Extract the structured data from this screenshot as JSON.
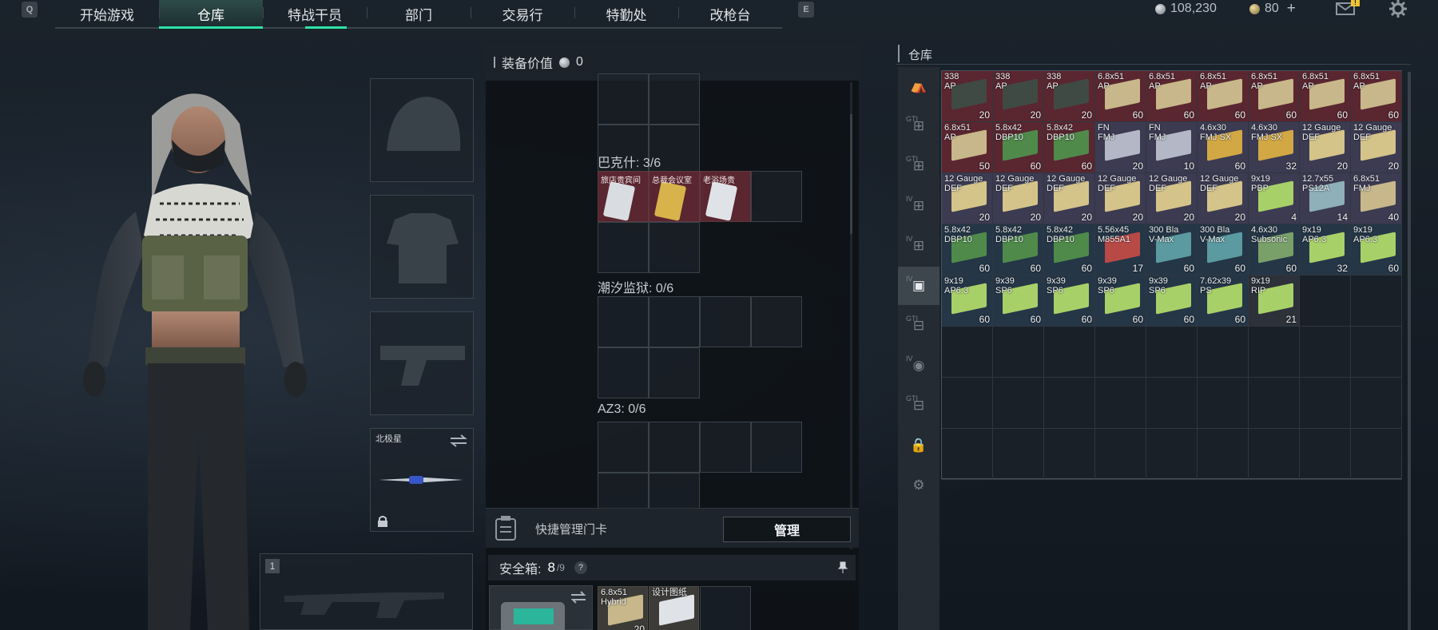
{
  "nav": {
    "left_key": "Q",
    "right_key": "E",
    "tabs": [
      {
        "label": "开始游戏",
        "active": false
      },
      {
        "label": "仓库",
        "active": true
      },
      {
        "label": "特战干员",
        "active": false
      },
      {
        "label": "部门",
        "active": false
      },
      {
        "label": "交易行",
        "active": false
      },
      {
        "label": "特勤处",
        "active": false
      },
      {
        "label": "改枪台",
        "active": false
      }
    ],
    "accent": "#2ee3a6"
  },
  "currency": {
    "silver": "108,230",
    "gold": "80",
    "add": "+",
    "mail_badge": "!"
  },
  "equipment": {
    "melee_label": "北极星"
  },
  "loadout": {
    "value_label": "装备价值",
    "value": "0",
    "sections": [
      {
        "label": "巴克什: 3/6"
      },
      {
        "label": "潮汐监狱: 0/6"
      },
      {
        "label": "AZ3: 0/6"
      }
    ],
    "keycards": [
      {
        "label": "旅店贵宾间"
      },
      {
        "label": "总裁会议室"
      },
      {
        "label": "老浴场贵"
      }
    ],
    "quick_card_label": "快捷管理门卡",
    "manage_button": "管理",
    "safebox_label": "安全箱:",
    "safebox_used": "8",
    "safebox_total": "/9",
    "safebox_help": "?",
    "safebox_items": [
      {
        "name": "6.8x51\nHybrid",
        "qty": "20"
      },
      {
        "name": "设计图纸",
        "qty": ""
      }
    ],
    "primary_slot_num": "1"
  },
  "warehouse": {
    "title": "仓库",
    "sidebar_labels": [
      "GTI",
      "GTI",
      "IV",
      "IV",
      "IV",
      "GTI",
      "IV",
      "GTI"
    ],
    "items": [
      [
        {
          "n": "338\nAP",
          "q": "20",
          "bg": "#5a2630",
          "box": "#3f4a44"
        },
        {
          "n": "338\nAP",
          "q": "20",
          "bg": "#5a2630",
          "box": "#3f4a44"
        },
        {
          "n": "338\nAP",
          "q": "20",
          "bg": "#5a2630",
          "box": "#3f4a44"
        },
        {
          "n": "6.8x51\nAP",
          "q": "60",
          "bg": "#5a2630",
          "box": "#c8b78a"
        },
        {
          "n": "6.8x51\nAP",
          "q": "60",
          "bg": "#5a2630",
          "box": "#c8b78a"
        },
        {
          "n": "6.8x51\nAP",
          "q": "60",
          "bg": "#5a2630",
          "box": "#c8b78a"
        },
        {
          "n": "6.8x51\nAP",
          "q": "60",
          "bg": "#5a2630",
          "box": "#c8b78a"
        },
        {
          "n": "6.8x51\nAP",
          "q": "60",
          "bg": "#5a2630",
          "box": "#c8b78a"
        },
        {
          "n": "6.8x51\nAP",
          "q": "60",
          "bg": "#5a2630",
          "box": "#c8b78a"
        }
      ],
      [
        {
          "n": "6.8x51\nAP",
          "q": "50",
          "bg": "#5a2630",
          "box": "#c8b78a"
        },
        {
          "n": "5.8x42\nDBP10",
          "q": "60",
          "bg": "#5a2630",
          "box": "#4f8a4a"
        },
        {
          "n": "5.8x42\nDBP10",
          "q": "60",
          "bg": "#5a2630",
          "box": "#4f8a4a"
        },
        {
          "n": "FN\nFMJ",
          "q": "20",
          "bg": "#3c3b52",
          "box": "#b4b8c6"
        },
        {
          "n": "FN\nFMJ",
          "q": "10",
          "bg": "#3c3b52",
          "box": "#b4b8c6"
        },
        {
          "n": "4.6x30\nFMJ SX",
          "q": "60",
          "bg": "#3c3b52",
          "box": "#d2a844"
        },
        {
          "n": "4.6x30\nFMJ SX",
          "q": "32",
          "bg": "#3c3b52",
          "box": "#d2a844"
        },
        {
          "n": "12 Gauge\nDEF",
          "q": "20",
          "bg": "#3c3b52",
          "box": "#d5c48a"
        },
        {
          "n": "12 Gauge\nDEF",
          "q": "20",
          "bg": "#3c3b52",
          "box": "#d5c48a"
        }
      ],
      [
        {
          "n": "12 Gauge\nDEF",
          "q": "20",
          "bg": "#3c3b52",
          "box": "#d5c48a"
        },
        {
          "n": "12 Gauge\nDEF",
          "q": "20",
          "bg": "#3c3b52",
          "box": "#d5c48a"
        },
        {
          "n": "12 Gauge\nDEF",
          "q": "20",
          "bg": "#3c3b52",
          "box": "#d5c48a"
        },
        {
          "n": "12 Gauge\nDEF",
          "q": "20",
          "bg": "#3c3b52",
          "box": "#d5c48a"
        },
        {
          "n": "12 Gauge\nDEF",
          "q": "20",
          "bg": "#3c3b52",
          "box": "#d5c48a"
        },
        {
          "n": "12 Gauge\nDEF",
          "q": "20",
          "bg": "#3c3b52",
          "box": "#d5c48a"
        },
        {
          "n": "9x19\nPBP",
          "q": "4",
          "bg": "#3c3b52",
          "box": "#a8d068"
        },
        {
          "n": "12.7x55\nPS12A",
          "q": "14",
          "bg": "#3c3b52",
          "box": "#8fb0b8"
        },
        {
          "n": "6.8x51\nFMJ",
          "q": "40",
          "bg": "#3c3b52",
          "box": "#c8b78a"
        }
      ],
      [
        {
          "n": "5.8x42\nDBP10",
          "q": "60",
          "bg": "#253647",
          "box": "#4f8a4a"
        },
        {
          "n": "5.8x42\nDBP10",
          "q": "60",
          "bg": "#253647",
          "box": "#4f8a4a"
        },
        {
          "n": "5.8x42\nDBP10",
          "q": "60",
          "bg": "#253647",
          "box": "#4f8a4a"
        },
        {
          "n": "5.56x45\nM855A1",
          "q": "17",
          "bg": "#253647",
          "box": "#b84a46"
        },
        {
          "n": "300 Bla\nV-Max",
          "q": "60",
          "bg": "#253647",
          "box": "#5a9aa0"
        },
        {
          "n": "300 Bla\nV-Max",
          "q": "60",
          "bg": "#253647",
          "box": "#5a9aa0"
        },
        {
          "n": "4.6x30\nSubsonic",
          "q": "60",
          "bg": "#253647",
          "box": "#7aa06a"
        },
        {
          "n": "9x19\nAP6.3",
          "q": "32",
          "bg": "#253647",
          "box": "#a8d068"
        },
        {
          "n": "9x19\nAP6.3",
          "q": "60",
          "bg": "#253647",
          "box": "#a8d068"
        }
      ],
      [
        {
          "n": "9x19\nAP6.3",
          "q": "60",
          "bg": "#253647",
          "box": "#a8d068"
        },
        {
          "n": "9x39\nSP6",
          "q": "60",
          "bg": "#253647",
          "box": "#a8d068"
        },
        {
          "n": "9x39\nSP6",
          "q": "60",
          "bg": "#253647",
          "box": "#a8d068"
        },
        {
          "n": "9x39\nSP6",
          "q": "60",
          "bg": "#253647",
          "box": "#a8d068"
        },
        {
          "n": "9x39\nSP6",
          "q": "60",
          "bg": "#253647",
          "box": "#a8d068"
        },
        {
          "n": "7.62x39\nPS",
          "q": "60",
          "bg": "#253647",
          "box": "#a8d068"
        },
        {
          "n": "9x19\nRIP",
          "q": "21",
          "bg": "#2c313a",
          "box": "#a8d068"
        }
      ]
    ]
  }
}
